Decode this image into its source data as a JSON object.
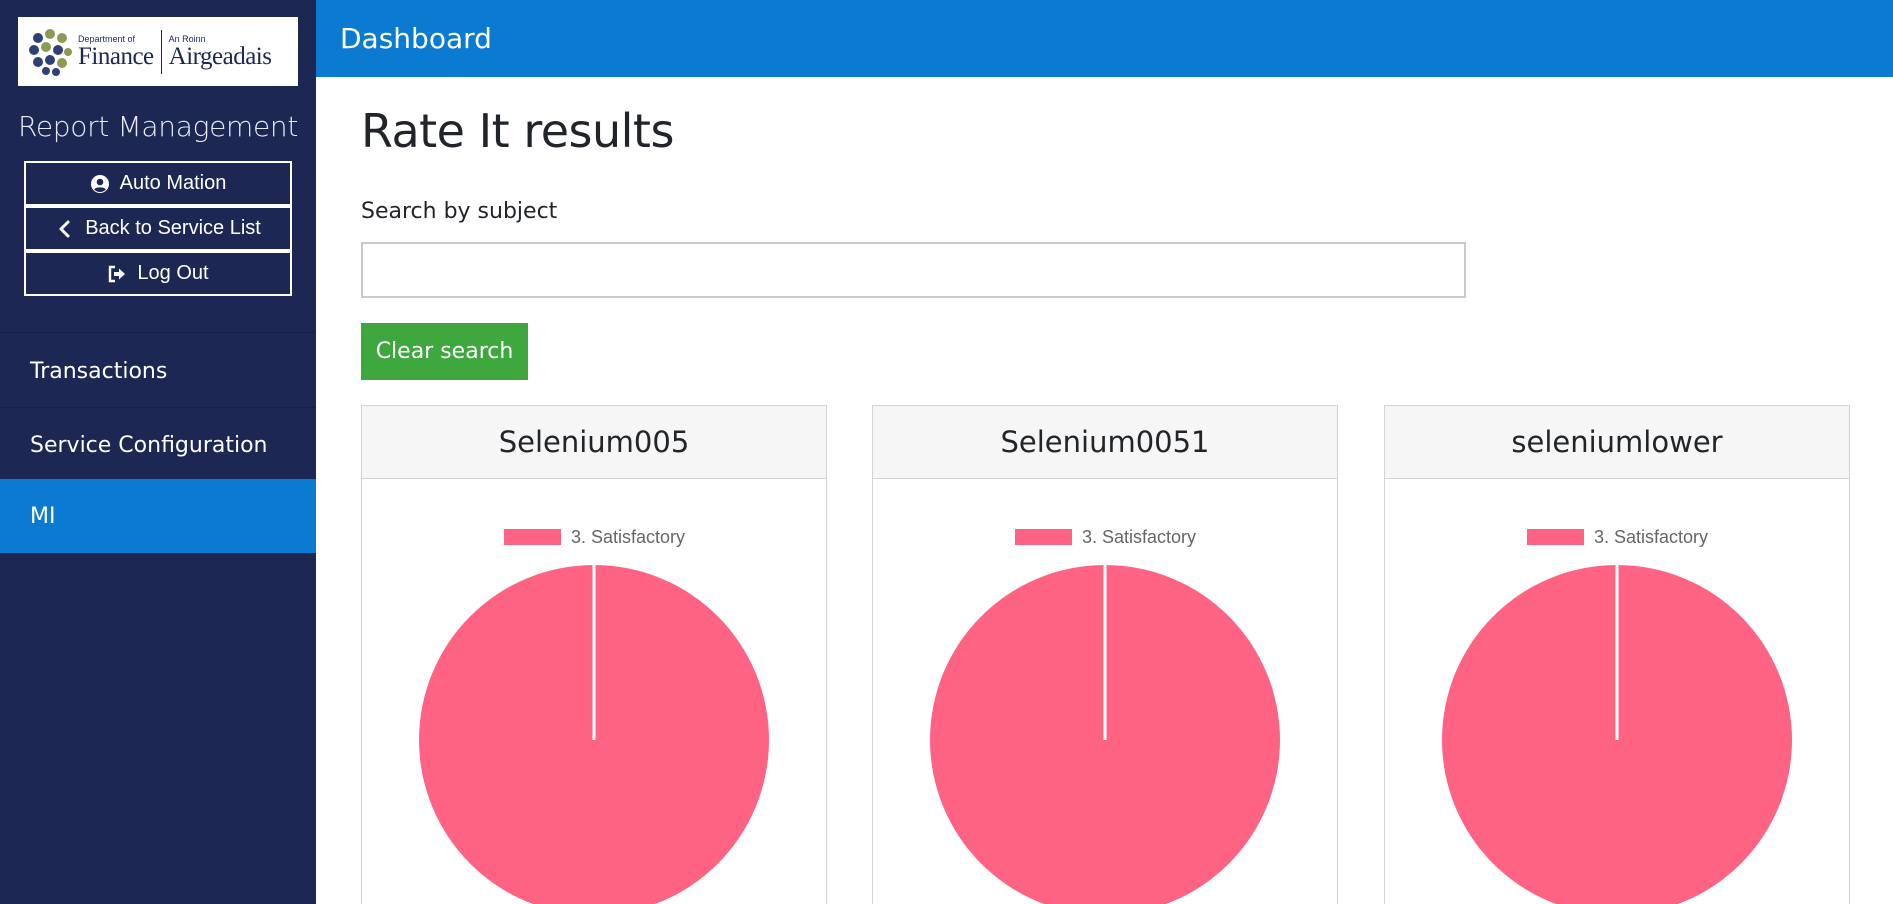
{
  "logo": {
    "line1_small": "Department of",
    "line1_big": "Finance",
    "line2_small": "An Roinn",
    "line2_big": "Airgeadais"
  },
  "sidebar": {
    "report_title": "Report Management",
    "buttons": [
      {
        "label": "Auto Mation",
        "icon": "user-circle-icon"
      },
      {
        "label": "Back to Service List",
        "icon": "chevron-left-icon"
      },
      {
        "label": "Log Out",
        "icon": "sign-out-icon"
      }
    ],
    "nav": [
      {
        "label": "Transactions",
        "active": false
      },
      {
        "label": "Service Configuration",
        "active": false
      },
      {
        "label": "MI",
        "active": true
      }
    ]
  },
  "header": {
    "title": "Dashboard"
  },
  "main": {
    "title": "Rate It results",
    "search": {
      "label": "Search by subject",
      "value": "",
      "placeholder": ""
    },
    "clear_label": "Clear search"
  },
  "colors": {
    "sidebar_bg": "#1c2753",
    "accent_blue": "#0b7ad1",
    "clear_green": "#3ea83e",
    "pie_pink": "#ff6384"
  },
  "chart_data": [
    {
      "type": "pie",
      "title": "Selenium005",
      "categories": [
        "3. Satisfactory"
      ],
      "values": [
        1
      ],
      "colors": [
        "#ff6384"
      ],
      "legend": "top"
    },
    {
      "type": "pie",
      "title": "Selenium0051",
      "categories": [
        "3. Satisfactory"
      ],
      "values": [
        1
      ],
      "colors": [
        "#ff6384"
      ],
      "legend": "top"
    },
    {
      "type": "pie",
      "title": "seleniumlower",
      "categories": [
        "3. Satisfactory"
      ],
      "values": [
        1
      ],
      "colors": [
        "#ff6384"
      ],
      "legend": "top"
    }
  ]
}
